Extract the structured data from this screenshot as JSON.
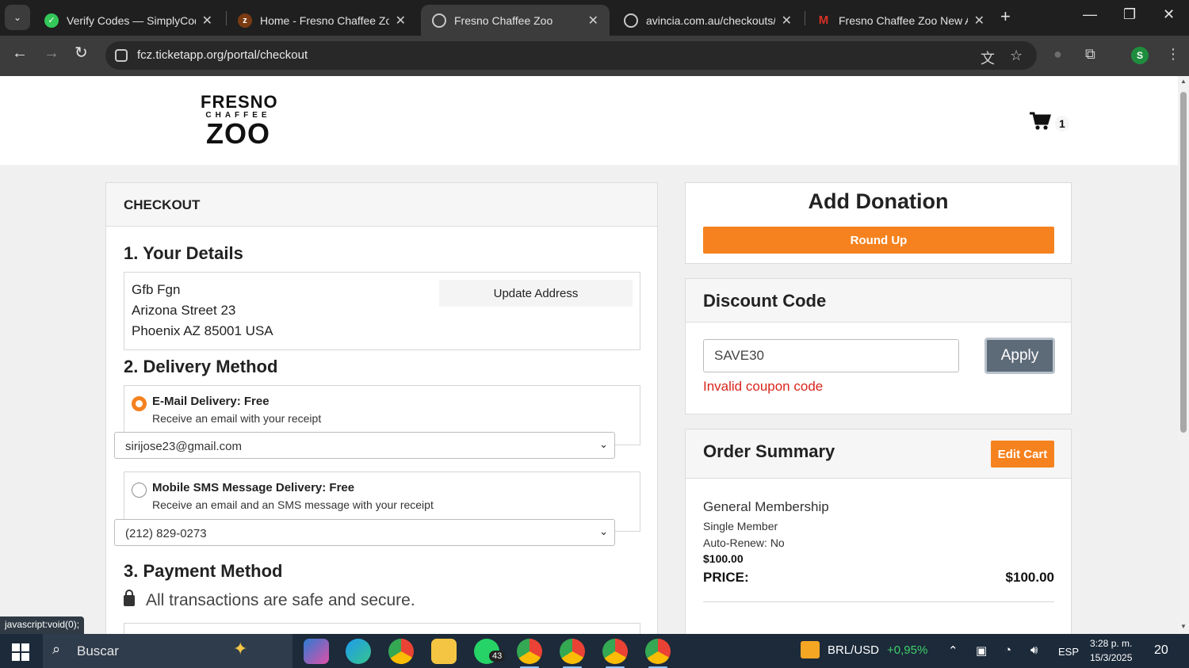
{
  "browser": {
    "tabs": [
      {
        "title": "Verify Codes — SimplyCodes",
        "icon": "simplycodes-icon",
        "color": "#34c759"
      },
      {
        "title": "Home - Fresno Chaffee Zoo",
        "icon": "zoo-icon",
        "color": "#7a3b12"
      },
      {
        "title": "Fresno Chaffee Zoo",
        "icon": "globe-icon",
        "color": "#5f6368",
        "active": true
      },
      {
        "title": "avincia.com.au/checkouts/cn",
        "icon": "globe-icon",
        "color": "#5f6368"
      },
      {
        "title": "Fresno Chaffee Zoo New Acc",
        "icon": "gmail-icon",
        "color": "#d93025"
      }
    ],
    "url": "fcz.ticketapp.org/portal/checkout",
    "status_hint": "javascript:void(0);"
  },
  "site": {
    "logo": {
      "line1": "FRESNO",
      "line2": "CHAFFEE",
      "line3": "ZOO"
    },
    "cart_count": "1"
  },
  "checkout": {
    "title": "CHECKOUT",
    "details": {
      "heading": "1. Your Details",
      "name": "Gfb Fgn",
      "street": "Arizona Street 23",
      "city_line": "Phoenix AZ 85001 USA",
      "update_button": "Update Address"
    },
    "delivery": {
      "heading": "2. Delivery Method",
      "options": [
        {
          "title": "E-Mail Delivery: Free",
          "subtitle": "Receive an email with your receipt",
          "select_value": "sirijose23@gmail.com",
          "checked": true
        },
        {
          "title": "Mobile SMS Message Delivery: Free",
          "subtitle": "Receive an email and an SMS message with your receipt",
          "select_value": "(212) 829-0273",
          "checked": false
        }
      ]
    },
    "payment": {
      "heading": "3. Payment Method",
      "secure_text": "All transactions are safe and secure."
    }
  },
  "donation": {
    "title": "Add Donation",
    "round_up": "Round Up"
  },
  "discount": {
    "title": "Discount Code",
    "code_value": "SAVE30",
    "apply": "Apply",
    "error": "Invalid coupon code"
  },
  "summary": {
    "title": "Order Summary",
    "edit_cart": "Edit Cart",
    "item": {
      "name": "General Membership",
      "type": "Single Member",
      "auto_renew": "Auto-Renew: No",
      "price": "$100.00"
    },
    "price_label": "PRICE:",
    "price_value": "$100.00"
  },
  "taskbar": {
    "search_placeholder": "Buscar",
    "whatsapp_badge": "43",
    "ticker_pair": "BRL/USD",
    "ticker_change": "+0,95%",
    "language": "ESP",
    "time": "3:28 p. m.",
    "date": "15/3/2025",
    "notifications": "20"
  },
  "colors": {
    "accent_orange": "#f5821f",
    "error_red": "#d9251c",
    "apply_gray": "#5d6a78"
  }
}
